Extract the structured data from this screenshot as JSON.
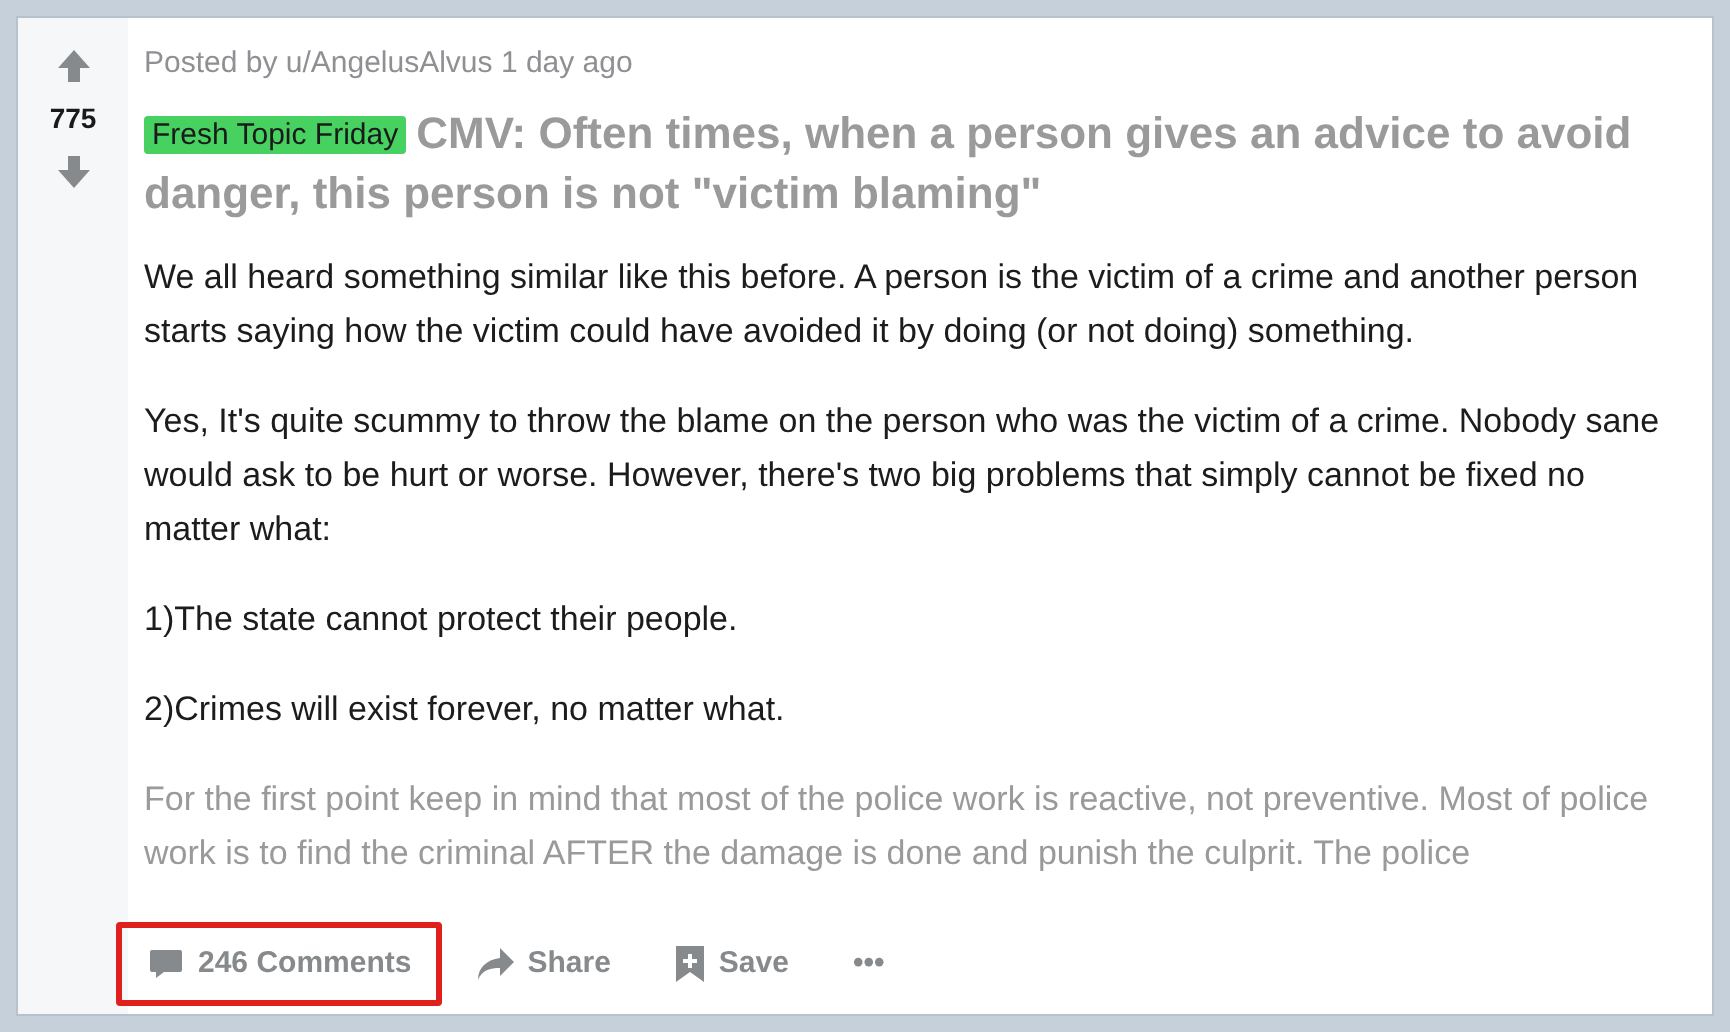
{
  "vote": {
    "score": "775"
  },
  "post": {
    "meta": "Posted by u/AngelusAlvus 1 day ago",
    "flair": {
      "label": "Fresh Topic Friday",
      "color": "#46d160"
    },
    "title": "CMV: Often times, when a person gives an advice to avoid danger, this person is not \"victim blaming\"",
    "paragraphs": [
      {
        "text": "We all heard something similar like this before. A person is the victim of a crime and another person starts saying how the victim could have avoided it by doing (or not doing) something.",
        "faded": false
      },
      {
        "text": "Yes, It's quite scummy to throw the blame on the person who was the victim of a crime. Nobody sane would ask to be hurt or worse. However, there's two big problems that simply cannot be fixed no matter what:",
        "faded": false
      },
      {
        "text": "1)The state cannot protect their people.",
        "faded": false
      },
      {
        "text": "2)Crimes will exist forever, no matter what.",
        "faded": false
      },
      {
        "text": "For the first point keep in mind that most of the police work is reactive, not preventive. Most of police work is to find the criminal AFTER the damage is done and punish the culprit. The police",
        "faded": true
      }
    ]
  },
  "actions": [
    {
      "kind": "comments",
      "label": "246 Comments",
      "highlighted": true
    },
    {
      "kind": "share",
      "label": "Share",
      "highlighted": false
    },
    {
      "kind": "save",
      "label": "Save",
      "highlighted": false
    },
    {
      "kind": "more",
      "label": "•••",
      "highlighted": false
    }
  ]
}
